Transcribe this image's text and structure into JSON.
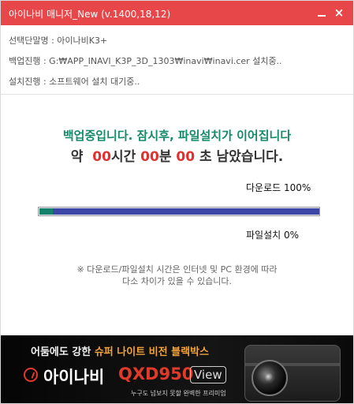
{
  "window": {
    "title": "아이나비 매니저_New (v.1400,18,12)",
    "minimize_glyph": "_",
    "close_glyph": "×",
    "title_bar_color": "#e8474a"
  },
  "info": {
    "device": "선택단말명 : 아이나비K3+",
    "backup": "백업진행 : G:₩APP_INAVI_K3P_3D_1303₩inavi₩inavi.cer 설치중..",
    "install": "설치진행 : 소프트웨어 설치 대기중.."
  },
  "status": {
    "message": "백업중입니다. 잠시후, 파일설치가 이어집니다",
    "remaining_prefix": "약",
    "hours": "00",
    "hours_unit": "시간",
    "minutes": "00",
    "minutes_unit": "분",
    "seconds": "00",
    "seconds_suffix": "초 남았습니다."
  },
  "download": {
    "label": "다운로드 100%",
    "value": 100
  },
  "file_install": {
    "label": "파일설치 0%",
    "value": 0
  },
  "notice": {
    "line1": "※ 다운로드/파일설치 시간은 인터넷 및 PC 환경에 따라",
    "line2": "다소 차이가 있을 수 있습니다."
  },
  "banner": {
    "tagline_prefix": "어둠에도 강한",
    "tagline_rest": "슈퍼 나이트 비전 블랙박스",
    "brand": "아이나비",
    "model": "QXD950",
    "view": "View",
    "subtext": "누구도 넘보지 못할 완벽한 프리미엄"
  },
  "colors": {
    "accent_red": "#e03030",
    "teal_text": "#148a6a",
    "progress_blue": "#3b46a6",
    "progress_teal": "#14826a"
  }
}
